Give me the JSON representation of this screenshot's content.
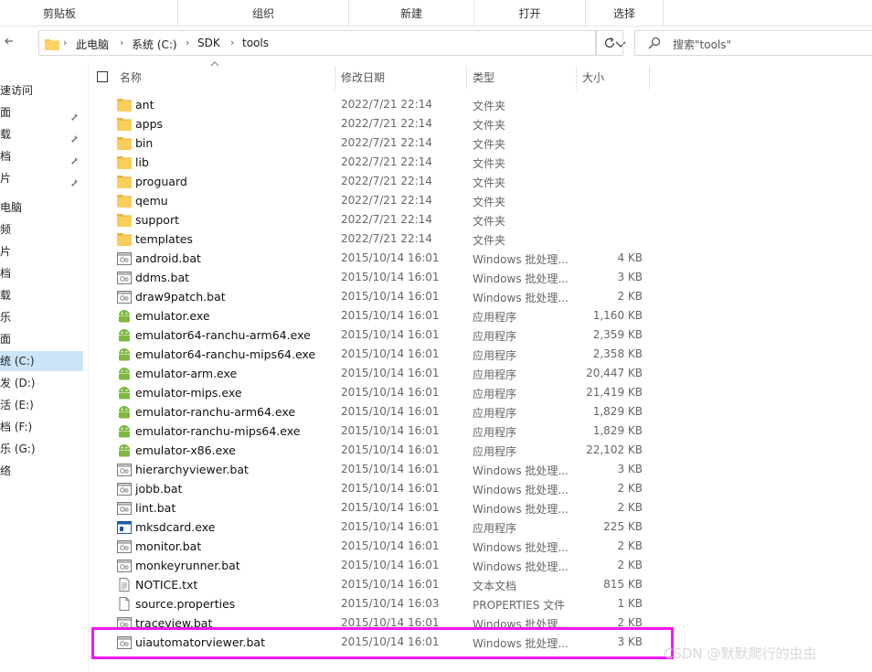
{
  "ribbon": {
    "groups": [
      "剪贴板",
      "组织",
      "新建",
      "打开",
      "选择"
    ]
  },
  "address": {
    "crumbs": [
      "此电脑",
      "系统 (C:)",
      "SDK",
      "tools"
    ]
  },
  "search": {
    "placeholder": "搜索\"tools\""
  },
  "nav": {
    "items": [
      {
        "label": "速访问",
        "pinned": false
      },
      {
        "label": "面",
        "pinned": true
      },
      {
        "label": "载",
        "pinned": true
      },
      {
        "label": "档",
        "pinned": true
      },
      {
        "label": "片",
        "pinned": true
      },
      {
        "label": "电脑",
        "pinned": false
      },
      {
        "label": "频",
        "pinned": false
      },
      {
        "label": "片",
        "pinned": false
      },
      {
        "label": "档",
        "pinned": false
      },
      {
        "label": "载",
        "pinned": false
      },
      {
        "label": "乐",
        "pinned": false
      },
      {
        "label": "面",
        "pinned": false
      },
      {
        "label": "统 (C:)",
        "pinned": false,
        "selected": true
      },
      {
        "label": "发 (D:)",
        "pinned": false
      },
      {
        "label": "活 (E:)",
        "pinned": false
      },
      {
        "label": "档 (F:)",
        "pinned": false
      },
      {
        "label": "乐 (G:)",
        "pinned": false
      },
      {
        "label": "络",
        "pinned": false
      }
    ]
  },
  "columns": {
    "name": "名称",
    "date": "修改日期",
    "type": "类型",
    "size": "大小"
  },
  "files": [
    {
      "name": "ant",
      "date": "2022/7/21 22:14",
      "type": "文件夹",
      "size": "",
      "icon": "folder-icon"
    },
    {
      "name": "apps",
      "date": "2022/7/21 22:14",
      "type": "文件夹",
      "size": "",
      "icon": "folder-icon"
    },
    {
      "name": "bin",
      "date": "2022/7/21 22:14",
      "type": "文件夹",
      "size": "",
      "icon": "folder-icon"
    },
    {
      "name": "lib",
      "date": "2022/7/21 22:14",
      "type": "文件夹",
      "size": "",
      "icon": "folder-icon"
    },
    {
      "name": "proguard",
      "date": "2022/7/21 22:14",
      "type": "文件夹",
      "size": "",
      "icon": "folder-icon"
    },
    {
      "name": "qemu",
      "date": "2022/7/21 22:14",
      "type": "文件夹",
      "size": "",
      "icon": "folder-icon"
    },
    {
      "name": "support",
      "date": "2022/7/21 22:14",
      "type": "文件夹",
      "size": "",
      "icon": "folder-icon"
    },
    {
      "name": "templates",
      "date": "2022/7/21 22:14",
      "type": "文件夹",
      "size": "",
      "icon": "folder-icon"
    },
    {
      "name": "android.bat",
      "date": "2015/10/14 16:01",
      "type": "Windows 批处理...",
      "size": "4 KB",
      "icon": "batch-file-icon"
    },
    {
      "name": "ddms.bat",
      "date": "2015/10/14 16:01",
      "type": "Windows 批处理...",
      "size": "3 KB",
      "icon": "batch-file-icon"
    },
    {
      "name": "draw9patch.bat",
      "date": "2015/10/14 16:01",
      "type": "Windows 批处理...",
      "size": "2 KB",
      "icon": "batch-file-icon"
    },
    {
      "name": "emulator.exe",
      "date": "2015/10/14 16:01",
      "type": "应用程序",
      "size": "1,160 KB",
      "icon": "android-icon"
    },
    {
      "name": "emulator64-ranchu-arm64.exe",
      "date": "2015/10/14 16:01",
      "type": "应用程序",
      "size": "2,359 KB",
      "icon": "android-icon"
    },
    {
      "name": "emulator64-ranchu-mips64.exe",
      "date": "2015/10/14 16:01",
      "type": "应用程序",
      "size": "2,358 KB",
      "icon": "android-icon"
    },
    {
      "name": "emulator-arm.exe",
      "date": "2015/10/14 16:01",
      "type": "应用程序",
      "size": "20,447 KB",
      "icon": "android-icon"
    },
    {
      "name": "emulator-mips.exe",
      "date": "2015/10/14 16:01",
      "type": "应用程序",
      "size": "21,419 KB",
      "icon": "android-icon"
    },
    {
      "name": "emulator-ranchu-arm64.exe",
      "date": "2015/10/14 16:01",
      "type": "应用程序",
      "size": "1,829 KB",
      "icon": "android-icon"
    },
    {
      "name": "emulator-ranchu-mips64.exe",
      "date": "2015/10/14 16:01",
      "type": "应用程序",
      "size": "1,829 KB",
      "icon": "android-icon"
    },
    {
      "name": "emulator-x86.exe",
      "date": "2015/10/14 16:01",
      "type": "应用程序",
      "size": "22,102 KB",
      "icon": "android-icon"
    },
    {
      "name": "hierarchyviewer.bat",
      "date": "2015/10/14 16:01",
      "type": "Windows 批处理...",
      "size": "3 KB",
      "icon": "batch-file-icon"
    },
    {
      "name": "jobb.bat",
      "date": "2015/10/14 16:01",
      "type": "Windows 批处理...",
      "size": "2 KB",
      "icon": "batch-file-icon"
    },
    {
      "name": "lint.bat",
      "date": "2015/10/14 16:01",
      "type": "Windows 批处理...",
      "size": "2 KB",
      "icon": "batch-file-icon"
    },
    {
      "name": "mksdcard.exe",
      "date": "2015/10/14 16:01",
      "type": "应用程序",
      "size": "225 KB",
      "icon": "application-icon"
    },
    {
      "name": "monitor.bat",
      "date": "2015/10/14 16:01",
      "type": "Windows 批处理...",
      "size": "2 KB",
      "icon": "batch-file-icon"
    },
    {
      "name": "monkeyrunner.bat",
      "date": "2015/10/14 16:01",
      "type": "Windows 批处理...",
      "size": "2 KB",
      "icon": "batch-file-icon"
    },
    {
      "name": "NOTICE.txt",
      "date": "2015/10/14 16:01",
      "type": "文本文档",
      "size": "815 KB",
      "icon": "text-file-icon"
    },
    {
      "name": "source.properties",
      "date": "2015/10/14 16:03",
      "type": "PROPERTIES 文件",
      "size": "1 KB",
      "icon": "blank-file-icon"
    },
    {
      "name": "traceview.bat",
      "date": "2015/10/14 16:01",
      "type": "Windows 批处理...",
      "size": "2 KB",
      "icon": "batch-file-icon"
    },
    {
      "name": "uiautomatorviewer.bat",
      "date": "2015/10/14 16:01",
      "type": "Windows 批处理...",
      "size": "3 KB",
      "icon": "batch-file-icon"
    }
  ],
  "watermark": "CSDN @默默爬行的虫虫",
  "colors": {
    "highlight": "#f218f2",
    "selected_nav": "#cce4f7",
    "folder": "#f6c851",
    "android": "#7cba3f"
  }
}
